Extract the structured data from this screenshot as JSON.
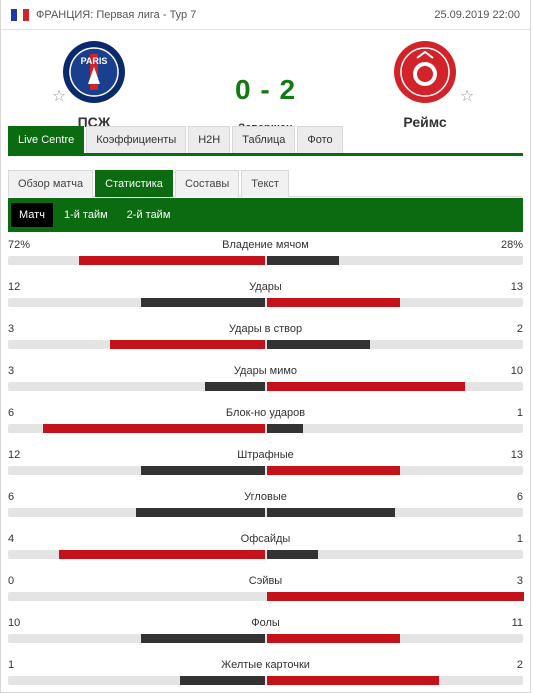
{
  "header": {
    "league": "ФРАНЦИЯ: Первая лига - Тур 7",
    "date": "25.09.2019 22:00",
    "flag_colors": [
      "#1f3aa8",
      "#ffffff",
      "#d2232a"
    ]
  },
  "match": {
    "home": {
      "name": "ПСЖ",
      "logo": "psg-logo",
      "logo_text": "PARIS"
    },
    "away": {
      "name": "Реймс",
      "logo": "reims-logo"
    },
    "score": "0 - 2",
    "status": "Завершен"
  },
  "main_tabs": [
    {
      "label": "Live Centre",
      "active": true
    },
    {
      "label": "Коэффициенты",
      "active": false
    },
    {
      "label": "H2H",
      "active": false
    },
    {
      "label": "Таблица",
      "active": false
    },
    {
      "label": "Фото",
      "active": false
    }
  ],
  "sub_tabs": [
    {
      "label": "Обзор матча",
      "active": false
    },
    {
      "label": "Статистика",
      "active": true
    },
    {
      "label": "Составы",
      "active": false
    },
    {
      "label": "Текст",
      "active": false
    }
  ],
  "period_tabs": [
    {
      "label": "Матч",
      "active": true
    },
    {
      "label": "1-й тайм",
      "active": false
    },
    {
      "label": "2-й тайм",
      "active": false
    }
  ],
  "colors": {
    "accent": "#0b6b10",
    "winner_bar": "#c4121b",
    "loser_bar": "#333333",
    "track": "#e4e4e4",
    "score": "#127a12"
  },
  "stats": [
    {
      "label": "Владение мячом",
      "home": "72%",
      "away": "28%",
      "home_share": 0.72,
      "away_share": 0.28
    },
    {
      "label": "Удары",
      "home": "12",
      "away": "13",
      "home_share": 0.48,
      "away_share": 0.52
    },
    {
      "label": "Удары в створ",
      "home": "3",
      "away": "2",
      "home_share": 0.6,
      "away_share": 0.4
    },
    {
      "label": "Удары мимо",
      "home": "3",
      "away": "10",
      "home_share": 0.23,
      "away_share": 0.77
    },
    {
      "label": "Блок-но ударов",
      "home": "6",
      "away": "1",
      "home_share": 0.86,
      "away_share": 0.14
    },
    {
      "label": "Штрафные",
      "home": "12",
      "away": "13",
      "home_share": 0.48,
      "away_share": 0.52
    },
    {
      "label": "Угловые",
      "home": "6",
      "away": "6",
      "home_share": 0.5,
      "away_share": 0.5
    },
    {
      "label": "Офсайды",
      "home": "4",
      "away": "1",
      "home_share": 0.8,
      "away_share": 0.2
    },
    {
      "label": "Сэйвы",
      "home": "0",
      "away": "3",
      "home_share": 0.0,
      "away_share": 1.0
    },
    {
      "label": "Фолы",
      "home": "10",
      "away": "11",
      "home_share": 0.48,
      "away_share": 0.52
    },
    {
      "label": "Желтые карточки",
      "home": "1",
      "away": "2",
      "home_share": 0.33,
      "away_share": 0.67
    }
  ]
}
